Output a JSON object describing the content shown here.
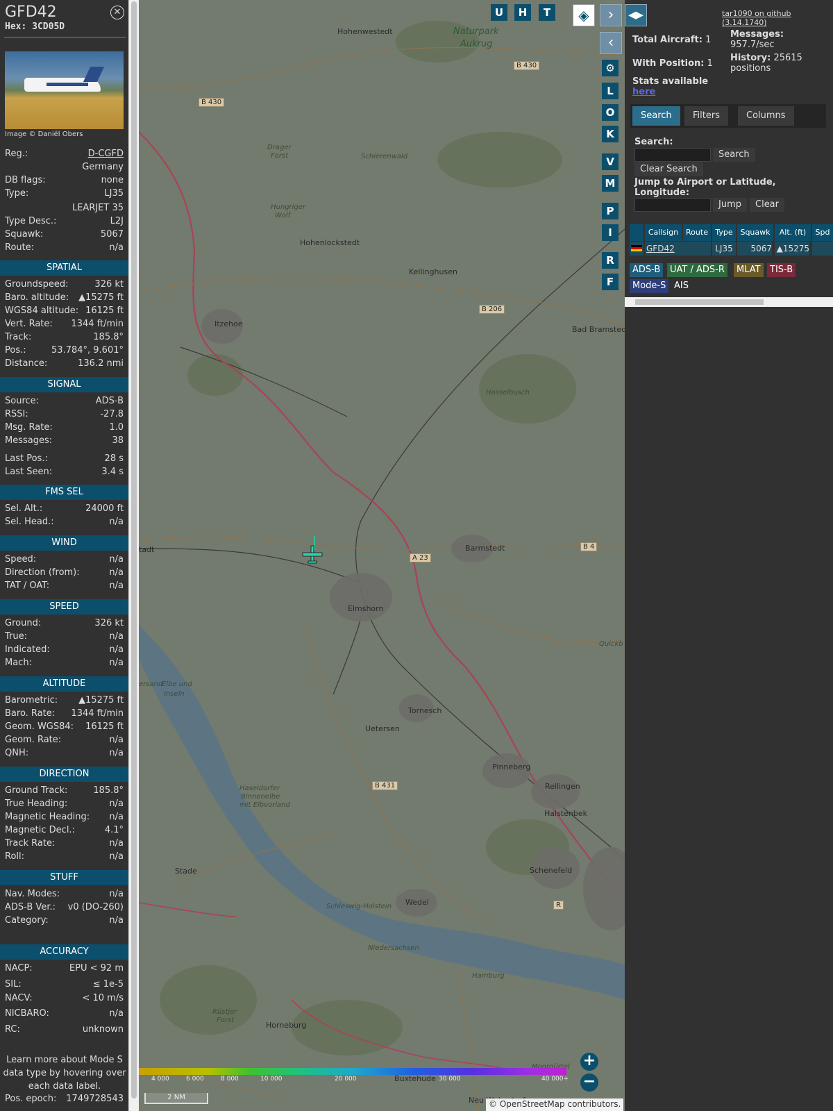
{
  "aircraft": {
    "callsign": "GFD42",
    "hex": "Hex: 3CD05D",
    "photo_credit": "Image © Daniël Obers"
  },
  "basic": [
    {
      "k": "Reg.:",
      "v": "D-CGFD",
      "link": true
    },
    {
      "k": "",
      "v": "Germany"
    },
    {
      "k": "DB flags:",
      "v": "none"
    },
    {
      "k": "Type:",
      "v": "LJ35"
    },
    {
      "k": "",
      "v": "LEARJET 35"
    },
    {
      "k": "Type Desc.:",
      "v": "L2J"
    },
    {
      "k": "Squawk:",
      "v": "5067"
    },
    {
      "k": "Route:",
      "v": "n/a"
    }
  ],
  "sections": {
    "spatial": "SPATIAL",
    "signal": "SIGNAL",
    "fms": "FMS SEL",
    "wind": "WIND",
    "speed": "SPEED",
    "altitude": "ALTITUDE",
    "direction": "DIRECTION",
    "stuff": "STUFF",
    "accuracy": "ACCURACY"
  },
  "spatial": [
    {
      "k": "Groundspeed:",
      "v": "326 kt"
    },
    {
      "k": "Baro. altitude:",
      "v": "▲15275 ft"
    },
    {
      "k": "WGS84 altitude:",
      "v": "16125 ft"
    },
    {
      "k": "Vert. Rate:",
      "v": "1344 ft/min"
    },
    {
      "k": "Track:",
      "v": "185.8°"
    },
    {
      "k": "Pos.:",
      "v": "53.784°, 9.601°"
    },
    {
      "k": "Distance:",
      "v": "136.2 nmi"
    }
  ],
  "signal": [
    {
      "k": "Source:",
      "v": "ADS-B"
    },
    {
      "k": "RSSI:",
      "v": "-27.8"
    },
    {
      "k": "Msg. Rate:",
      "v": "1.0"
    },
    {
      "k": "Messages:",
      "v": "38"
    },
    {
      "k": "Last Pos.:",
      "v": "28 s"
    },
    {
      "k": "Last Seen:",
      "v": "3.4 s"
    }
  ],
  "fms": [
    {
      "k": "Sel. Alt.:",
      "v": "24000 ft"
    },
    {
      "k": "Sel. Head.:",
      "v": "n/a"
    }
  ],
  "wind": [
    {
      "k": "Speed:",
      "v": "n/a"
    },
    {
      "k": "Direction (from):",
      "v": "n/a"
    },
    {
      "k": "TAT / OAT:",
      "v": "n/a"
    }
  ],
  "speed": [
    {
      "k": "Ground:",
      "v": "326 kt"
    },
    {
      "k": "True:",
      "v": "n/a"
    },
    {
      "k": "Indicated:",
      "v": "n/a"
    },
    {
      "k": "Mach:",
      "v": "n/a"
    }
  ],
  "altitude": [
    {
      "k": "Barometric:",
      "v": "▲15275 ft"
    },
    {
      "k": "Baro. Rate:",
      "v": "1344 ft/min"
    },
    {
      "k": "Geom. WGS84:",
      "v": "16125 ft"
    },
    {
      "k": "Geom. Rate:",
      "v": "n/a"
    },
    {
      "k": "QNH:",
      "v": "n/a"
    }
  ],
  "direction": [
    {
      "k": "Ground Track:",
      "v": "185.8°"
    },
    {
      "k": "True Heading:",
      "v": "n/a"
    },
    {
      "k": "Magnetic Heading:",
      "v": "n/a"
    },
    {
      "k": "Magnetic Decl.:",
      "v": "4.1°"
    },
    {
      "k": "Track Rate:",
      "v": "n/a"
    },
    {
      "k": "Roll:",
      "v": "n/a"
    }
  ],
  "stuff": [
    {
      "k": "Nav. Modes:",
      "v": "n/a"
    },
    {
      "k": "ADS-B Ver.:",
      "v": "v0 (DO-260)"
    },
    {
      "k": "Category:",
      "v": "n/a"
    }
  ],
  "accuracy": [
    {
      "k": "NACP:",
      "v": "EPU < 92 m"
    },
    {
      "k": "SIL:",
      "v": "≤ 1e-5"
    },
    {
      "k": "NACV:",
      "v": "< 10 m/s"
    },
    {
      "k": "NICBARO:",
      "v": "n/a"
    },
    {
      "k": "RC:",
      "v": "unknown"
    }
  ],
  "note": "Learn more about Mode S data type by hovering over each data label.",
  "pos_epoch": {
    "k": "Pos. epoch:",
    "v": "1749728543"
  },
  "map": {
    "places": [
      "Hohenwestedt",
      "Naturpark",
      "Aukrug",
      "Drager",
      "Forst",
      "Schierenwald",
      "Hungriger",
      "Wolf",
      "Hohenlockstedt",
      "Kellinghusen",
      "Itzehoe",
      "Bad Bramstedt",
      "Hasselbusch",
      "Barmstedt",
      "Elmshorn",
      "Quickb",
      "Elbe und",
      "Inseln",
      "Tornesch",
      "Uetersen",
      "Pinneberg",
      "Rellingen",
      "Halstenbek",
      "Haseldorfer",
      "Binnenelbe",
      "mit Elbvorland",
      "Stade",
      "Schenefeld",
      "Wedel",
      "Schleswig-Holstein",
      "Niedersachsen",
      "Hamburg",
      "Rüstjer",
      "Forst",
      "Horneburg",
      "Buxtehude",
      "Neu Wulmstorf",
      "Moorgürtel",
      "tadt",
      "ersand"
    ],
    "roads": [
      "B 430",
      "B 430",
      "B 206",
      "B 4",
      "A 23",
      "B 431",
      "R"
    ],
    "alt_ticks": [
      "4 000",
      "6 000",
      "8 000",
      "10 000",
      "20 000",
      "30 000",
      "40 000+"
    ],
    "scale": "2 NM",
    "attribution": "© OpenStreetMap contributors."
  },
  "controls": {
    "toggles": [
      "U",
      "H",
      "T"
    ],
    "side": [
      "L",
      "O",
      "K",
      "V",
      "M",
      "P",
      "I",
      "R",
      "F"
    ],
    "zoom_in": "+",
    "zoom_out": "−"
  },
  "right": {
    "github": "tar1090 on github (3.14.1740)",
    "total_label": "Total Aircraft:",
    "total": "1",
    "pos_label": "With Position:",
    "pos": "1",
    "msgs_label": "Messages:",
    "msgs": "957.7/sec",
    "hist_label": "History:",
    "hist": "25615 positions",
    "stats_label": "Stats available",
    "stats_link": "here",
    "tabs": [
      "Search",
      "Filters",
      "Columns"
    ],
    "search_label": "Search:",
    "search_btn": "Search",
    "clear_search": "Clear Search",
    "jump_label": "Jump to Airport or Latitude, Longitude:",
    "jump_btn": "Jump",
    "clear_btn": "Clear",
    "columns": [
      "Callsign",
      "Route",
      "Type",
      "Squawk",
      "Alt. (ft)",
      "Spd"
    ],
    "row": {
      "callsign": "GFD42",
      "route": "",
      "type": "LJ35",
      "squawk": "5067",
      "alt": "▲15275",
      "spd": ""
    },
    "sources": [
      {
        "label": "ADS-B",
        "color": "#1f5d7a"
      },
      {
        "label": "UAT / ADS-R",
        "color": "#2e6a3e"
      },
      {
        "label": "MLAT",
        "color": "#6a5a2a"
      },
      {
        "label": "TIS-B",
        "color": "#7a2a3a"
      },
      {
        "label": "Mode-S",
        "color": "#2e3e7a"
      },
      {
        "label": "AIS",
        "color": "#313131"
      }
    ]
  }
}
